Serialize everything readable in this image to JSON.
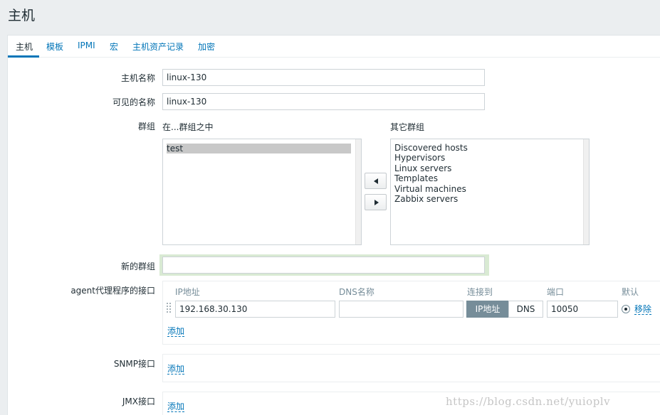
{
  "page": {
    "title": "主机"
  },
  "tabs": [
    {
      "label": "主机"
    },
    {
      "label": "模板"
    },
    {
      "label": "IPMI"
    },
    {
      "label": "宏"
    },
    {
      "label": "主机资产记录"
    },
    {
      "label": "加密"
    }
  ],
  "form": {
    "hostname": {
      "label": "主机名称",
      "value": "linux-130"
    },
    "visible_name": {
      "label": "可见的名称",
      "value": "linux-130"
    },
    "groups": {
      "label": "群组",
      "in_groups_label": "在...群组之中",
      "other_groups_label": "其它群组",
      "in_groups": [
        "test"
      ],
      "other_groups": [
        "Discovered hosts",
        "Hypervisors",
        "Linux servers",
        "Templates",
        "Virtual machines",
        "Zabbix servers"
      ]
    },
    "new_group": {
      "label": "新的群组",
      "value": ""
    },
    "agent_interface": {
      "label": "agent代理程序的接口",
      "columns": {
        "ip": "IP地址",
        "dns": "DNS名称",
        "connect": "连接到",
        "port": "端口",
        "default": "默认"
      },
      "ip_value": "192.168.30.130",
      "dns_value": "",
      "connect_ip_label": "IP地址",
      "connect_dns_label": "DNS",
      "port_value": "10050",
      "remove_label": "移除",
      "add_label": "添加"
    },
    "snmp_interface": {
      "label": "SNMP接口",
      "add_label": "添加"
    },
    "jmx_interface": {
      "label": "JMX接口",
      "add_label": "添加"
    }
  },
  "watermark": "https://blog.csdn.net/yuioplv",
  "colors": {
    "accent": "#0275b8",
    "selected_seg": "#768d99",
    "highlight_border": "#d9ead3"
  }
}
